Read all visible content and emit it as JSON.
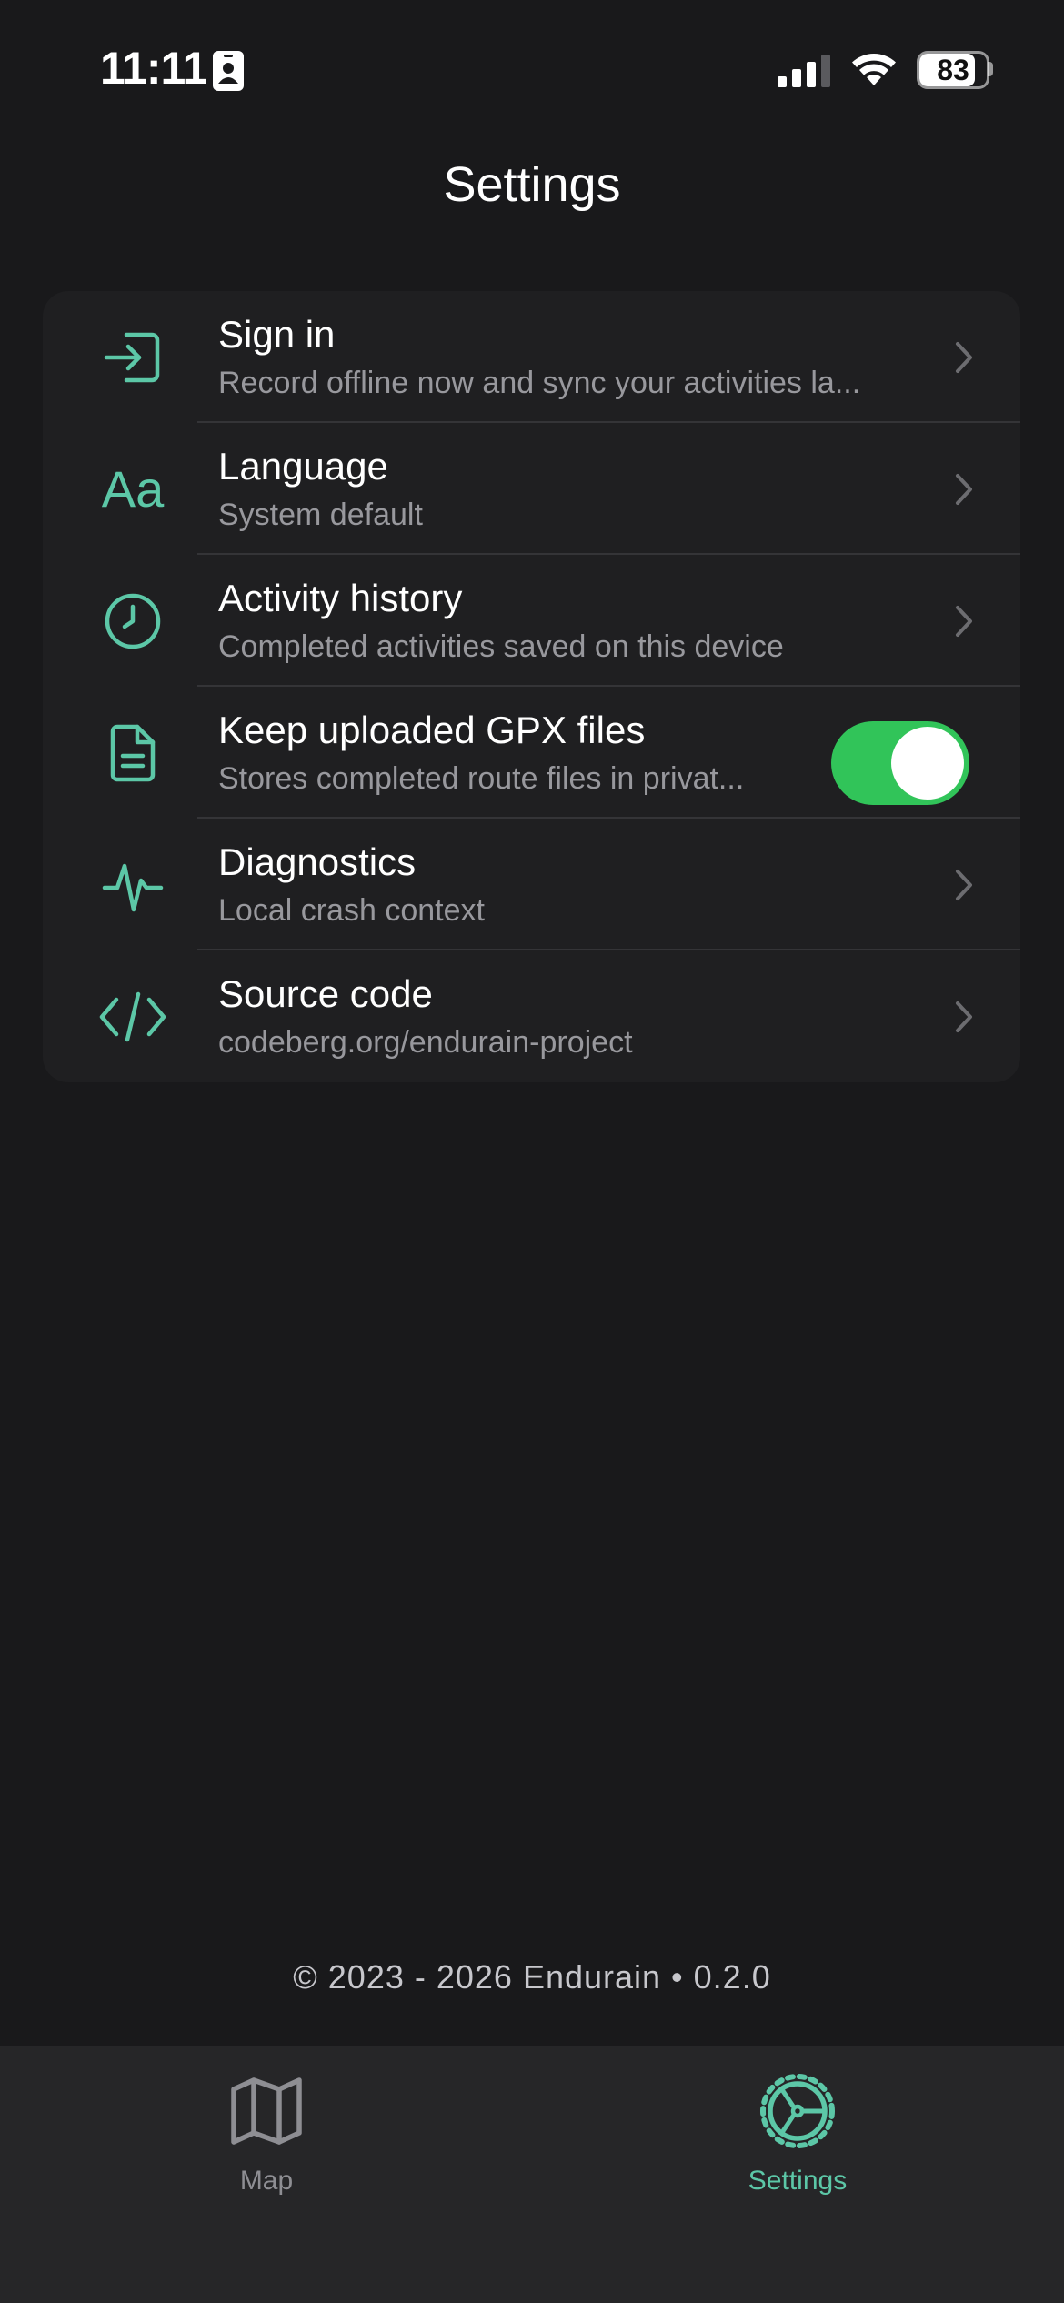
{
  "status_bar": {
    "time": "11:11",
    "battery": "83",
    "battery_level": 0.83
  },
  "header": {
    "title": "Settings"
  },
  "settings": {
    "items": [
      {
        "title": "Sign in",
        "subtitle": "Record offline now and sync your activities la...",
        "icon": "sign-in-icon",
        "control": "chevron"
      },
      {
        "title": "Language",
        "subtitle": "System default",
        "icon": "language-icon",
        "icon_text": "Aa",
        "control": "chevron"
      },
      {
        "title": "Activity history",
        "subtitle": "Completed activities saved on this device",
        "icon": "clock-icon",
        "control": "chevron"
      },
      {
        "title": "Keep uploaded GPX files",
        "subtitle": "Stores completed route files in privat...",
        "icon": "document-icon",
        "control": "toggle",
        "toggle_on": true
      },
      {
        "title": "Diagnostics",
        "subtitle": "Local crash context",
        "icon": "pulse-icon",
        "control": "chevron"
      },
      {
        "title": "Source code",
        "subtitle": "codeberg.org/endurain-project",
        "icon": "code-icon",
        "control": "chevron"
      }
    ]
  },
  "footer": {
    "text": "© 2023 - 2026 Endurain • 0.2.0"
  },
  "tab_bar": {
    "tabs": [
      {
        "label": "Map",
        "icon": "map-icon",
        "active": false
      },
      {
        "label": "Settings",
        "icon": "settings-icon",
        "active": true
      }
    ]
  },
  "colors": {
    "background": "#19191b",
    "card": "#1f1f21",
    "accent": "#5cc7a7",
    "toggle_on": "#31c459",
    "subtitle": "#98989d",
    "tab_bar": "#262628",
    "tab_inactive": "#8e8e93"
  }
}
